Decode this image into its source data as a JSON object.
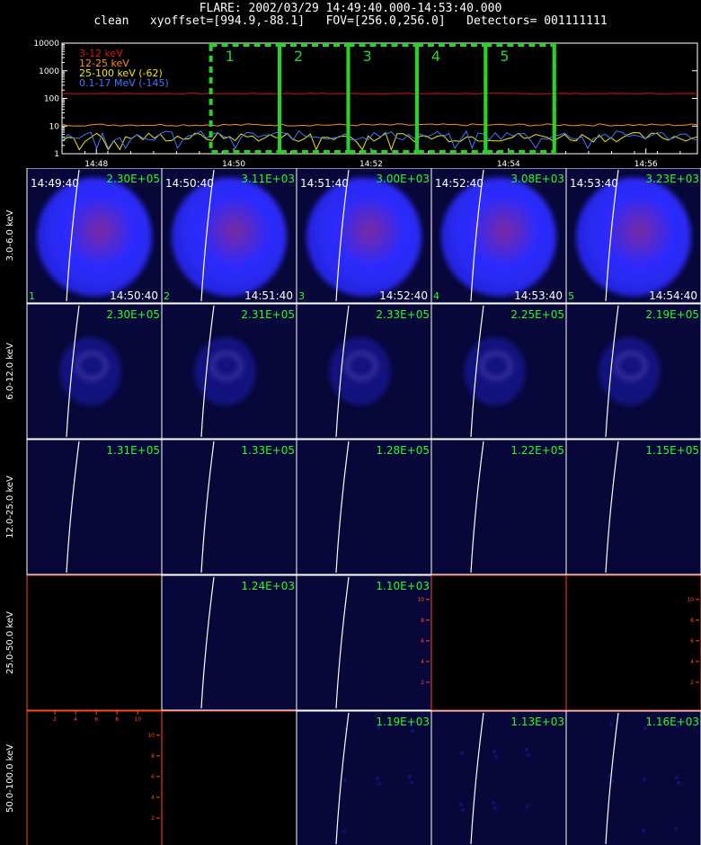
{
  "header": {
    "title": "FLARE: 2002/03/29 14:49:40.000-14:53:40.000",
    "subtitle": "clean   xyoffset=[994.9,-88.1]   FOV=[256.0,256.0]   Detectors= 001111111"
  },
  "chart_data": [
    {
      "type": "line",
      "scale": "log",
      "y_ticks": [
        "10000",
        "1000",
        "100",
        "10",
        "1"
      ],
      "x_ticks": [
        "14:48",
        "14:50",
        "14:52",
        "14:54",
        "14:56"
      ],
      "xlim": [
        "14:47:30",
        "14:56:45"
      ],
      "ylim": [
        1,
        10000
      ],
      "series": [
        {
          "name": "3-12 keV",
          "color": "#e01010",
          "level": 150
        },
        {
          "name": "12-25 keV",
          "color": "#ff8c1a",
          "level": 11
        },
        {
          "name": "25-100 keV (-62)",
          "color": "#f4e40f",
          "level": 4
        },
        {
          "name": "0.1-17 MeV (-145)",
          "color": "#3c78ff",
          "level": 4.5
        }
      ],
      "intervals": [
        {
          "label": "1",
          "start": "14:49:40",
          "end": "14:50:40"
        },
        {
          "label": "2",
          "start": "14:50:40",
          "end": "14:51:40"
        },
        {
          "label": "3",
          "start": "14:51:40",
          "end": "14:52:40"
        },
        {
          "label": "4",
          "start": "14:52:40",
          "end": "14:53:40"
        },
        {
          "label": "5",
          "start": "14:53:40",
          "end": "14:54:40"
        }
      ],
      "interval_color": "#2bd12b"
    },
    {
      "type": "heatmap",
      "energy_bands": [
        "3.0-6.0 keV",
        "6.0-12.0 keV",
        "12.0-25.0 keV",
        "25.0-50.0 keV",
        "50.0-100.0 keV"
      ],
      "start_times": [
        "14:49:40",
        "14:50:40",
        "14:51:40",
        "14:52:40",
        "14:53:40"
      ],
      "end_times": [
        "14:50:40",
        "14:51:40",
        "14:52:40",
        "14:53:40",
        "14:54:40"
      ],
      "interval_numbers": [
        "1",
        "2",
        "3",
        "4",
        "5"
      ],
      "max_values": [
        [
          "2.30E+05",
          "3.11E+03",
          "3.00E+03",
          "3.08E+03",
          "3.23E+03"
        ],
        [
          "2.30E+05",
          "2.31E+05",
          "2.33E+05",
          "2.25E+05",
          "2.19E+05"
        ],
        [
          "1.31E+05",
          "1.33E+05",
          "1.28E+05",
          "1.22E+05",
          "1.15E+05"
        ],
        [
          "",
          "1.24E+03",
          "1.10E+03",
          "",
          ""
        ],
        [
          "",
          "",
          "1.19E+03",
          "1.13E+03",
          "1.16E+03"
        ]
      ],
      "empty_panels": [
        [
          3,
          0
        ],
        [
          3,
          3
        ],
        [
          3,
          4
        ],
        [
          4,
          0
        ],
        [
          4,
          1
        ]
      ],
      "source_brightness": [
        1.0,
        0.35,
        0.0,
        0.0,
        0.05
      ],
      "panel_axis_ticks": [
        "2",
        "4",
        "6",
        "8",
        "10"
      ],
      "colors": {
        "background": "#07073a",
        "source": "#2b2bff",
        "core": "#7a2aa0",
        "label": "#22ff22",
        "empty_axes": "#ff4a1a",
        "limb": "#ffffff"
      }
    }
  ]
}
